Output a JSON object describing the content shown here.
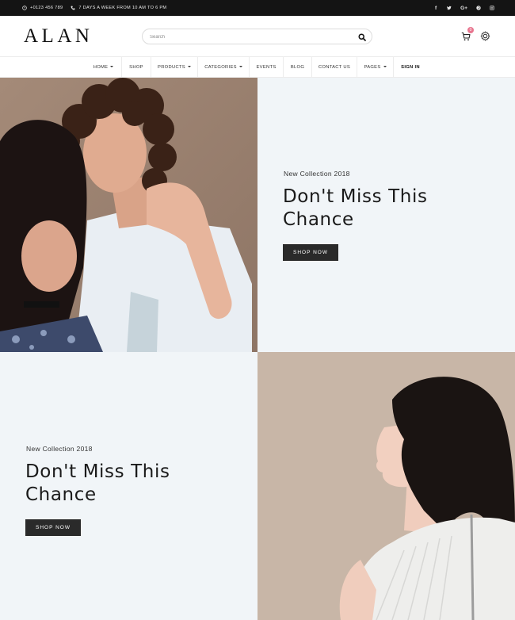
{
  "topbar": {
    "phone": "+0123 456 789",
    "hours": "7 DAYS A WEEK FROM 10 AM TO 6 PM",
    "social": [
      "facebook-icon",
      "twitter-icon",
      "google-plus-icon",
      "pinterest-icon",
      "instagram-icon"
    ],
    "social_labels": {
      "facebook": "f",
      "google_plus": "G+"
    }
  },
  "header": {
    "logo": "ALAN",
    "search_placeholder": "Search",
    "cart_count": "0"
  },
  "nav": {
    "items": [
      {
        "label": "HOME",
        "dropdown": true
      },
      {
        "label": "SHOP",
        "dropdown": false
      },
      {
        "label": "PRODUCTS",
        "dropdown": true
      },
      {
        "label": "CATEGORIES",
        "dropdown": true
      },
      {
        "label": "EVENTS",
        "dropdown": false
      },
      {
        "label": "BLOG",
        "dropdown": false
      },
      {
        "label": "CONTACT US",
        "dropdown": false
      },
      {
        "label": "PAGES",
        "dropdown": true
      },
      {
        "label": "SIGN IN",
        "dropdown": false
      }
    ]
  },
  "hero1": {
    "kicker": "New Collection 2018",
    "headline_line1": "Don't Miss This",
    "headline_line2": "Chance",
    "button": "SHOP NOW"
  },
  "hero2": {
    "kicker": "New Collection 2018",
    "headline_line1": "Don't Miss This",
    "headline_line2": "Chance",
    "button": "SHOP NOW"
  },
  "colors": {
    "topbar_bg": "#141414",
    "panel_bg": "#f1f5f8",
    "photo_bg_warm": "#9d8575",
    "photo_bg_beige": "#cbb9aa",
    "button_bg": "#2a2a2a",
    "badge": "#e8758f"
  }
}
